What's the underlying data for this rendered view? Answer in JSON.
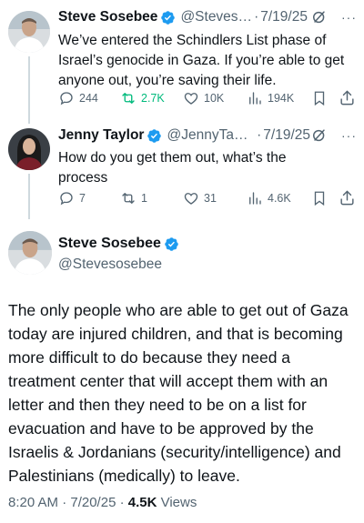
{
  "tweets": [
    {
      "name": "Steve Sosebee",
      "handle": "@Steves…",
      "date": "7/19/25",
      "text": "We’ve entered the Schindlers List phase of Israel’s  genocide in Gaza.  If you’re able to get anyone out, you’re saving their life.",
      "replies": "244",
      "retweets": "2.7K",
      "likes": "10K",
      "views": "194K"
    },
    {
      "name": "Jenny Taylor",
      "handle": "@JennyTa2…",
      "date": "7/19/25",
      "text": "How do you get them out, what’s the process",
      "replies": "7",
      "retweets": "1",
      "likes": "31",
      "views": "4.6K"
    }
  ],
  "main": {
    "name": "Steve Sosebee",
    "handle": "@Stevesosebee",
    "text": "The only people who are able to get out of Gaza today are injured children, and that is becoming more difficult to do because they need a treatment center that will accept them with an letter and then they need to be on a list for evacuation and have to be approved by the Israelis & Jordanians (security/intelligence) and Palestinians (medically) to leave.",
    "time": "8:20 AM · 7/20/25 · ",
    "views_count": "4.5K",
    "views_label": " Views"
  },
  "separator": "·",
  "more_glyph": "···",
  "colors": {
    "verified": "#1d9bf0",
    "retweet_active": "#00ba7c",
    "muted": "#536471"
  }
}
